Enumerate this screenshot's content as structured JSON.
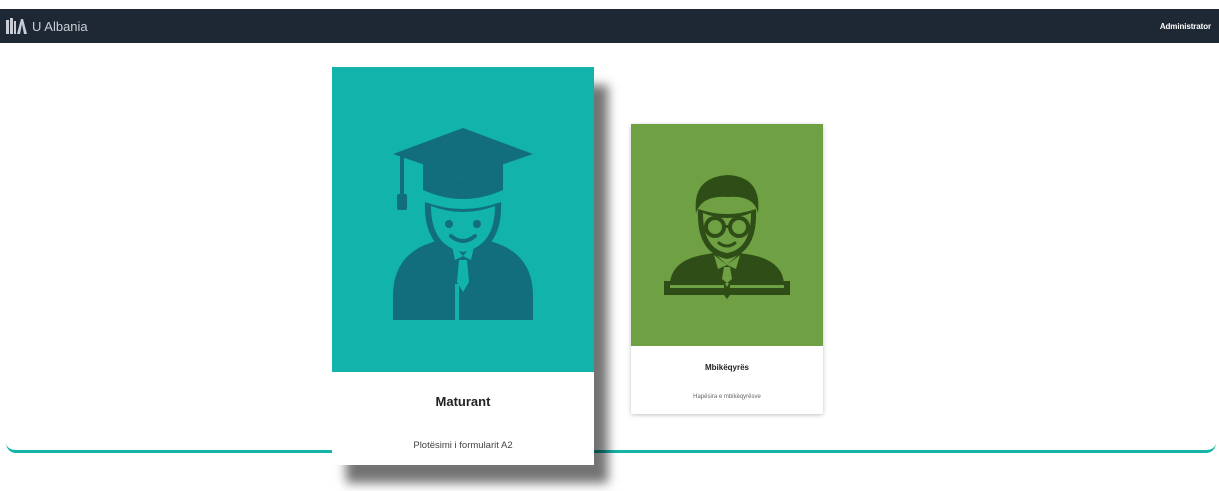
{
  "header": {
    "brand": "U Albania",
    "user": "Administrator",
    "logo_icon": "books-icon"
  },
  "cards": [
    {
      "title": "Maturant",
      "subtitle": "Plotësimi i formularit A2",
      "icon": "graduate-icon",
      "color": "#11b3ab"
    },
    {
      "title": "Mbikëqyrës",
      "subtitle": "Hapësira e mbikëqyrësve",
      "icon": "teacher-icon",
      "color": "#6fa043"
    }
  ],
  "colors": {
    "navbar": "#1e2835",
    "accent": "#16b4a8"
  }
}
